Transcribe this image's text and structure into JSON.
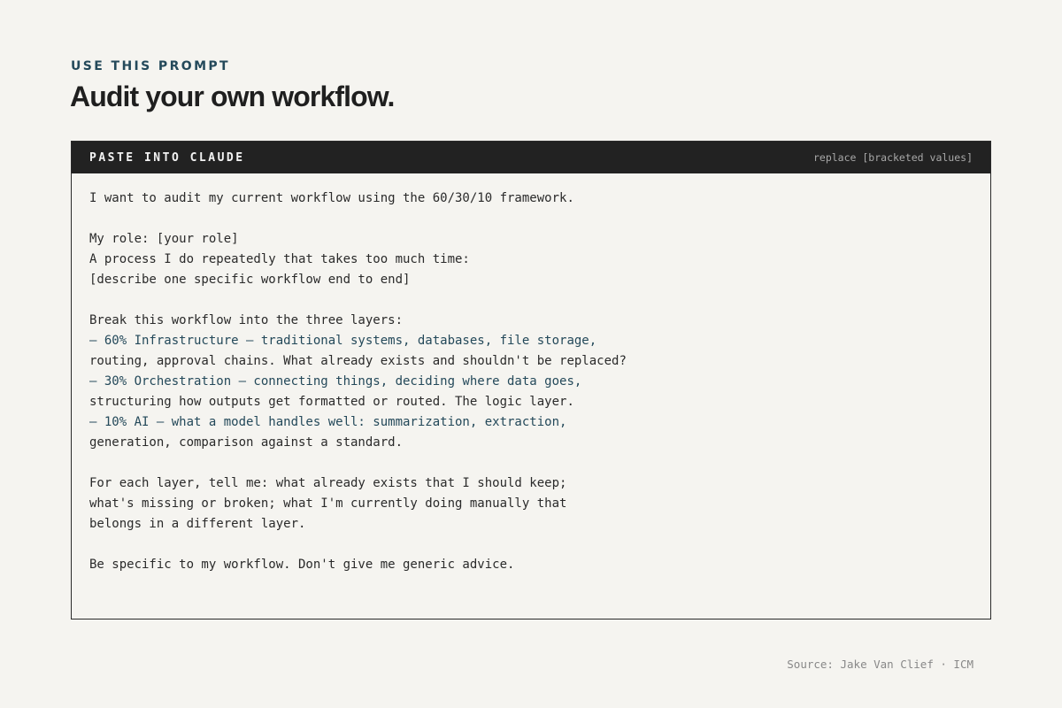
{
  "header": {
    "eyebrow": "USE THIS PROMPT",
    "title": "Audit your own workflow."
  },
  "card": {
    "label": "PASTE INTO CLAUDE",
    "hint": "replace [bracketed values]",
    "lines": [
      "I want to audit my current workflow using the 60/30/10 framework.",
      "",
      "My role: [your role]",
      "A process I do repeatedly that takes too much time:",
      "[describe one specific workflow end to end]",
      "",
      "Break this workflow into the three layers:",
      "– 60% Infrastructure — traditional systems, databases, file storage,",
      "routing, approval chains. What already exists and shouldn't be replaced?",
      "– 30% Orchestration — connecting things, deciding where data goes,",
      "structuring how outputs get formatted or routed. The logic layer.",
      "– 10% AI — what a model handles well: summarization, extraction,",
      "generation, comparison against a standard.",
      "",
      "For each layer, tell me: what already exists that I should keep;",
      "what's missing or broken; what I'm currently doing manually that",
      "belongs in a different layer.",
      "",
      "Be specific to my workflow. Don't give me generic advice."
    ]
  },
  "footer": {
    "source": "Source: Jake Van Clief · ICM"
  },
  "colors": {
    "accent": "#24495a",
    "background": "#f5f4f0",
    "header_bar": "#222222"
  }
}
